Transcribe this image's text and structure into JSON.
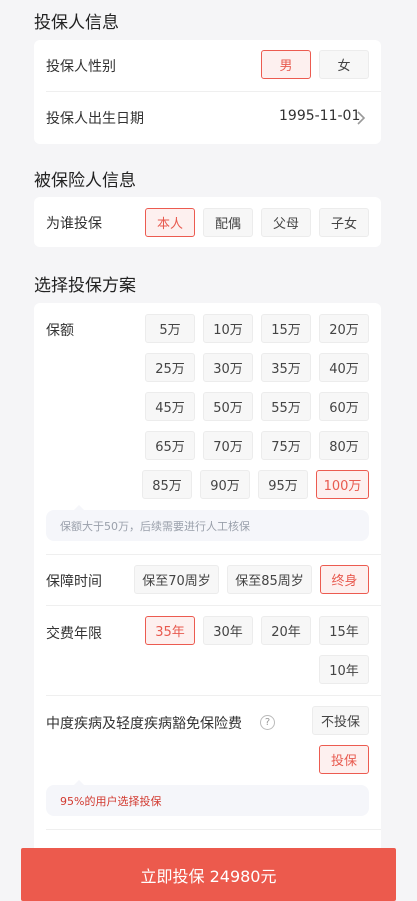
{
  "applicant": {
    "title": "投保人信息",
    "gender_label": "投保人性别",
    "gender_options": [
      "男",
      "女"
    ],
    "birth_label": "投保人出生日期",
    "birth_value": "1995-11-01"
  },
  "insured": {
    "title": "被保险人信息",
    "who_label": "为谁投保",
    "who_options": [
      "本人",
      "配偶",
      "父母",
      "子女"
    ]
  },
  "plan": {
    "title": "选择投保方案",
    "amount_label": "保额",
    "amounts": [
      "5万",
      "10万",
      "15万",
      "20万",
      "25万",
      "30万",
      "35万",
      "40万",
      "45万",
      "50万",
      "55万",
      "60万",
      "65万",
      "70万",
      "75万",
      "80万",
      "85万",
      "90万",
      "95万",
      "100万"
    ],
    "amount_hint": "保额大于50万，后续需要进行人工核保",
    "period_label": "保障时间",
    "period_options": [
      "保至70周岁",
      "保至85周岁",
      "终身"
    ],
    "pay_label": "交费年限",
    "pay_options": [
      "35年",
      "30年",
      "20年",
      "15年",
      "10年"
    ],
    "waiver_label": "中度疾病及轻度疾病豁免保险费",
    "waiver_help": "?",
    "waiver_options": [
      "不投保",
      "投保"
    ],
    "waiver_hint": "95%的用户选择投保"
  },
  "cta_label": "立即投保 24980元",
  "colors": {
    "accent": "#ec5a4d"
  }
}
